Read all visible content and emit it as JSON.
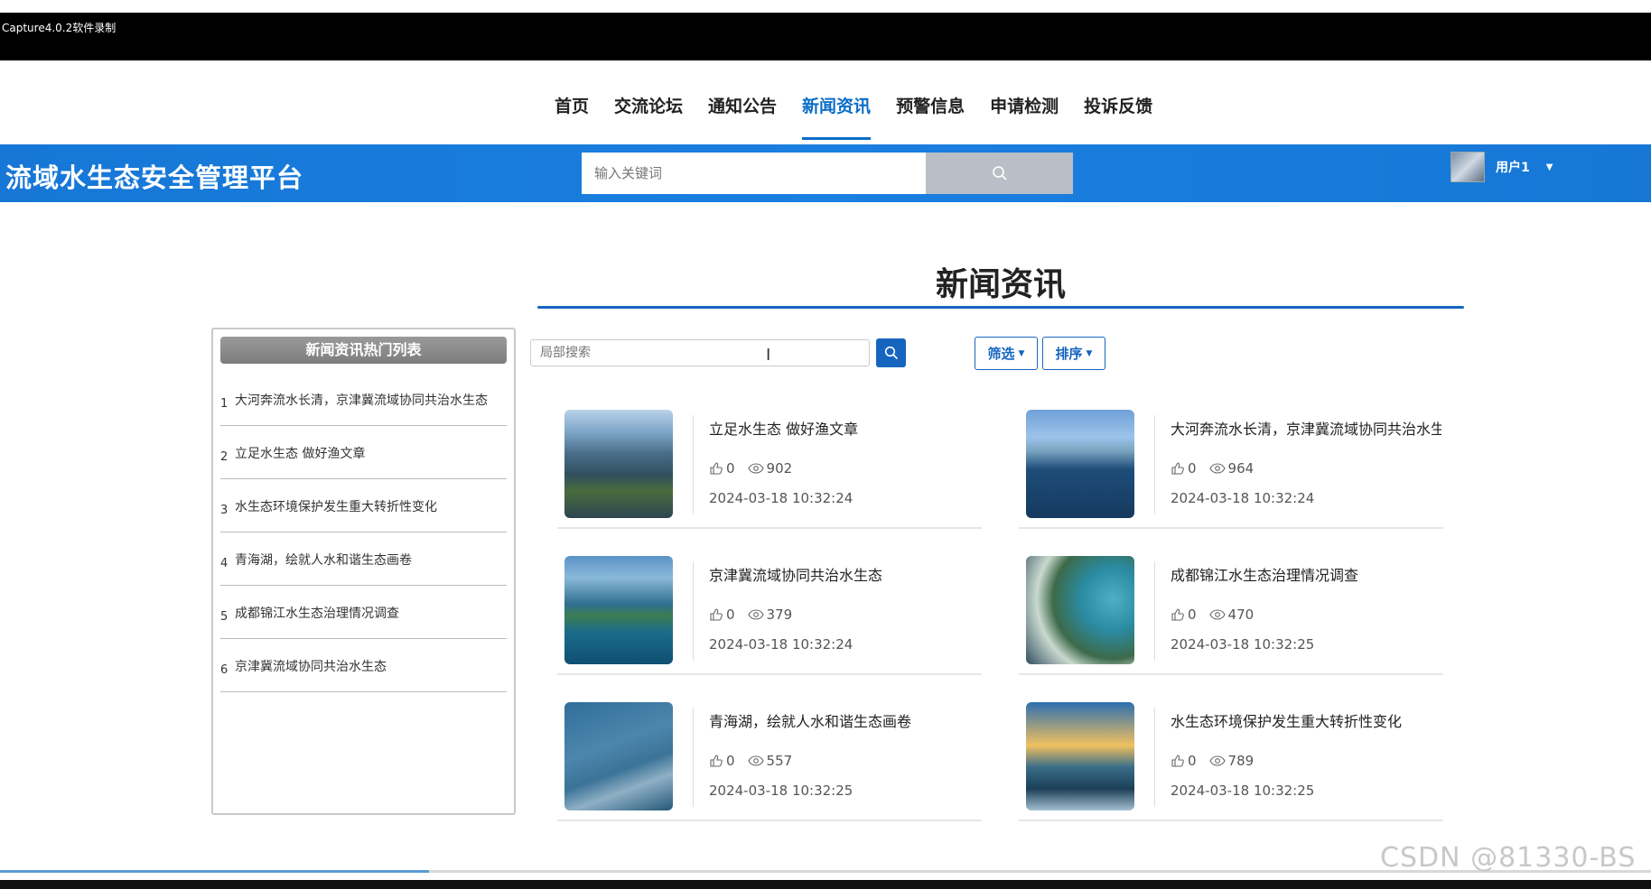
{
  "capture": {
    "title": "Capture4.0.2软件录制"
  },
  "nav": {
    "items": [
      "首页",
      "交流论坛",
      "通知公告",
      "新闻资讯",
      "预警信息",
      "申请检测",
      "投诉反馈"
    ],
    "active": "新闻资讯"
  },
  "header": {
    "logo": "流域水生态安全管理平台",
    "search_placeholder": "输入关键词",
    "user_name": "用户1"
  },
  "main": {
    "title": "新闻资讯"
  },
  "hot_list": {
    "title": "新闻资讯热门列表",
    "items": [
      {
        "num": "1",
        "label": "大河奔流水长清，京津冀流域协同共治水生态"
      },
      {
        "num": "2",
        "label": "立足水生态 做好渔文章"
      },
      {
        "num": "3",
        "label": "水生态环境保护发生重大转折性变化"
      },
      {
        "num": "4",
        "label": "青海湖，绘就人水和谐生态画卷"
      },
      {
        "num": "5",
        "label": "成都锦江水生态治理情况调查"
      },
      {
        "num": "6",
        "label": "京津冀流域协同共治水生态"
      }
    ]
  },
  "filters": {
    "local_search_placeholder": "局部搜索",
    "filter_label": "筛选",
    "sort_label": "排序"
  },
  "news": [
    {
      "title": "立足水生态 做好渔文章",
      "likes": "0",
      "views": "902",
      "date": "2024-03-18 10:32:24"
    },
    {
      "title": "大河奔流水长清，京津冀流域协同共治水生",
      "likes": "0",
      "views": "964",
      "date": "2024-03-18 10:32:24"
    },
    {
      "title": "京津冀流域协同共治水生态",
      "likes": "0",
      "views": "379",
      "date": "2024-03-18 10:32:24"
    },
    {
      "title": "成都锦江水生态治理情况调查",
      "likes": "0",
      "views": "470",
      "date": "2024-03-18 10:32:25"
    },
    {
      "title": "青海湖，绘就人水和谐生态画卷",
      "likes": "0",
      "views": "557",
      "date": "2024-03-18 10:32:25"
    },
    {
      "title": "水生态环境保护发生重大转折性变化",
      "likes": "0",
      "views": "789",
      "date": "2024-03-18 10:32:25"
    }
  ],
  "watermark": "CSDN @81330-BS",
  "colors": {
    "primary": "#1565c0",
    "banner": "#1a7fe0",
    "active_nav": "#0a6cc7"
  }
}
